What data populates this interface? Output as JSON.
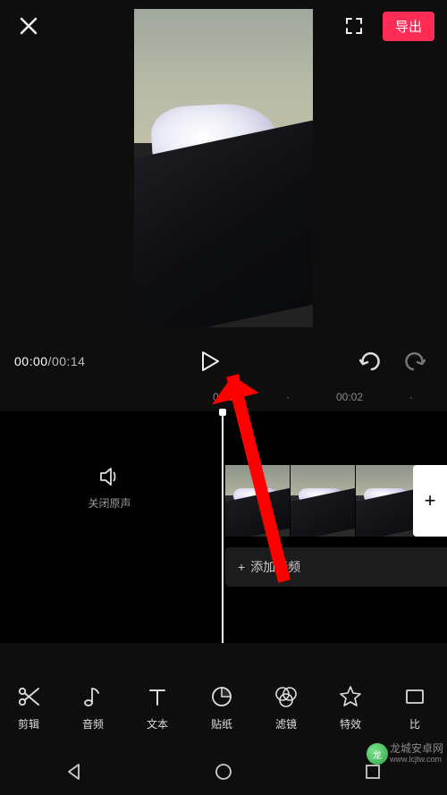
{
  "header": {
    "export_label": "导出"
  },
  "playback": {
    "current_time": "00:00",
    "total_time": "00:14"
  },
  "ruler": {
    "ticks": [
      "00:00",
      "00:02"
    ]
  },
  "mute": {
    "label": "关闭原声"
  },
  "audio_track": {
    "add_label": "添加音频"
  },
  "toolbar": {
    "items": [
      {
        "id": "edit",
        "label": "剪辑"
      },
      {
        "id": "audio",
        "label": "音频"
      },
      {
        "id": "text",
        "label": "文本"
      },
      {
        "id": "sticker",
        "label": "贴纸"
      },
      {
        "id": "filter",
        "label": "滤镜"
      },
      {
        "id": "effect",
        "label": "特效"
      },
      {
        "id": "ratio",
        "label": "比"
      }
    ]
  },
  "watermark": {
    "line1": "龙城安卓网",
    "line2": "www.lcjtw.com"
  }
}
